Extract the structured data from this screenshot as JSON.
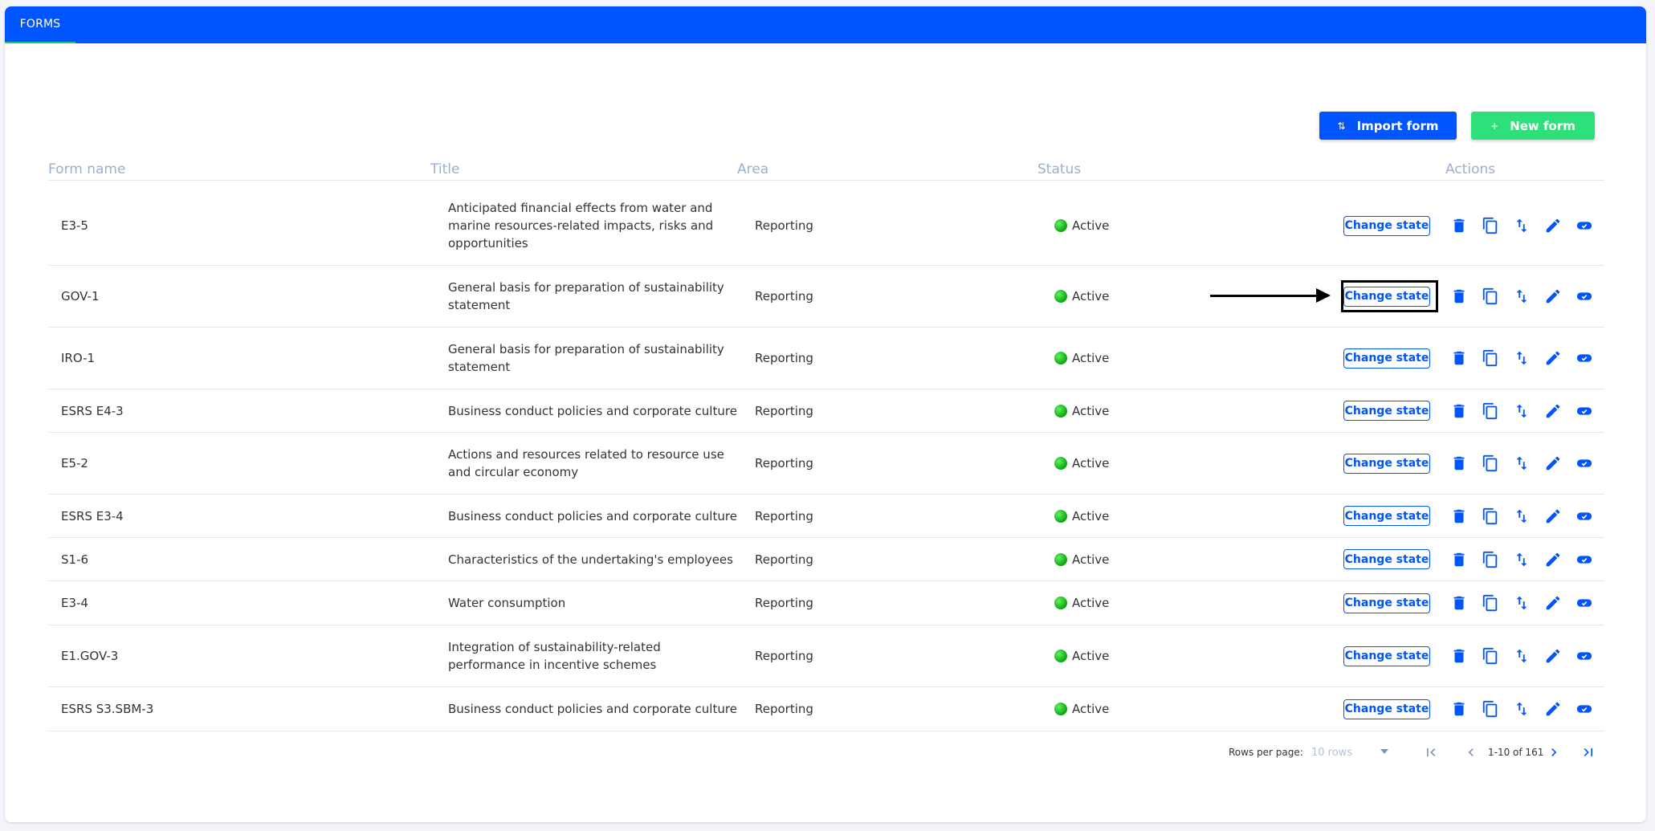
{
  "nav": {
    "tab_forms": "FORMS"
  },
  "toolbar": {
    "import_label": "Import form",
    "new_label": "New form",
    "import_icon": "⇅",
    "new_icon": "+"
  },
  "table": {
    "headers": {
      "name": "Form name",
      "title": "Title",
      "area": "Area",
      "status": "Status",
      "actions": "Actions"
    },
    "action_label": "Change state",
    "rows": [
      {
        "name": "E3-5",
        "title": "Anticipated financial effects from water and marine resources-related impacts, risks and opportunities",
        "area": "Reporting",
        "status": "Active"
      },
      {
        "name": "GOV-1",
        "title": "General basis for preparation of sustainability statement",
        "area": "Reporting",
        "status": "Active"
      },
      {
        "name": "IRO-1",
        "title": "General basis for preparation of sustainability statement",
        "area": "Reporting",
        "status": "Active"
      },
      {
        "name": "ESRS E4-3",
        "title": "Business conduct policies and corporate culture",
        "area": "Reporting",
        "status": "Active"
      },
      {
        "name": "E5-2",
        "title": "Actions and resources related to resource use and circular economy",
        "area": "Reporting",
        "status": "Active"
      },
      {
        "name": "ESRS E3-4",
        "title": "Business conduct policies and corporate culture",
        "area": "Reporting",
        "status": "Active"
      },
      {
        "name": "S1-6",
        "title": "Characteristics of the undertaking's employees",
        "area": "Reporting",
        "status": "Active"
      },
      {
        "name": "E3-4",
        "title": "Water consumption",
        "area": "Reporting",
        "status": "Active"
      },
      {
        "name": "E1.GOV-3",
        "title": "Integration of sustainability-related performance in incentive schemes",
        "area": "Reporting",
        "status": "Active"
      },
      {
        "name": "ESRS S3.SBM-3",
        "title": "Business conduct policies and corporate culture",
        "area": "Reporting",
        "status": "Active"
      }
    ]
  },
  "pagination": {
    "rows_per_page_label": "Rows per page:",
    "rows_per_page_value": "10 rows",
    "range": "1-10 of 161"
  },
  "colors": {
    "primary": "#0055ff",
    "accent_green": "#2ee07a",
    "status_active": "#0ea40e",
    "header_text": "#9ab0cf"
  },
  "icons": [
    "import-icon",
    "plus-icon",
    "trash-icon",
    "copy-icon",
    "swap-icon",
    "pencil-icon",
    "toggle-icon",
    "first-page-icon",
    "prev-page-icon",
    "next-page-icon",
    "last-page-icon"
  ]
}
